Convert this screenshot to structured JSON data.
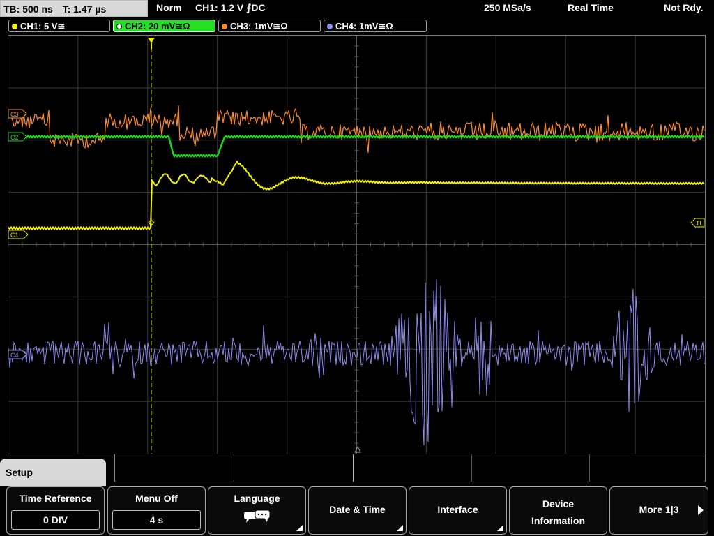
{
  "status": {
    "timebase": "TB: 500 ns",
    "trigger_time": "T: 1.47 µs",
    "mode": "Norm",
    "trigger": "CH1: 1.2 V ⨍DC",
    "sample_rate": "250 MSa/s",
    "acq_mode": "Real Time",
    "ready": "Not Rdy."
  },
  "channels": [
    {
      "label": "CH1: 5 V≅",
      "color": "#f4f400",
      "active": false
    },
    {
      "label": "CH2: 20 mV≅Ω",
      "color": "#1cd61c",
      "active": true
    },
    {
      "label": "CH3: 1mV≅Ω",
      "color": "#ff8c2a",
      "active": false
    },
    {
      "label": "CH4: 1mV≅Ω",
      "color": "#8c8cf0",
      "active": false
    }
  ],
  "markers": {
    "c1": "C1",
    "c2": "C2",
    "c3": "C3",
    "c4": "C4",
    "trigger_level": "TL"
  },
  "menu": {
    "title": "Setup",
    "softkeys": [
      {
        "label": "Time Reference",
        "value": "0 DIV"
      },
      {
        "label": "Menu Off",
        "value": "4 s"
      },
      {
        "label": "Language",
        "icon": "speech-bubbles-icon"
      },
      {
        "label": "Date & Time"
      },
      {
        "label": "Interface"
      },
      {
        "label_line1": "Device",
        "label_line2": "Information"
      },
      {
        "label": "More 1|3"
      }
    ]
  }
}
